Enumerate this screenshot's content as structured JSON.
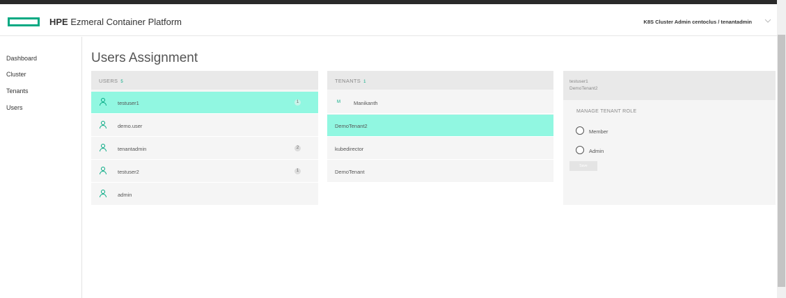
{
  "header": {
    "brand_bold": "HPE",
    "brand_rest": " Ezmeral Container Platform",
    "user_menu": "K8S Cluster Admin centoclus / tenantadmin"
  },
  "sidebar": {
    "items": [
      {
        "label": "Dashboard"
      },
      {
        "label": "Cluster"
      },
      {
        "label": "Tenants"
      },
      {
        "label": "Users"
      }
    ]
  },
  "page": {
    "title": "Users Assignment"
  },
  "users_panel": {
    "header_label": "USERS",
    "header_count": "5",
    "rows": [
      {
        "name": "testuser1",
        "count": "1",
        "selected": true
      },
      {
        "name": "demo.user",
        "count": null,
        "selected": false
      },
      {
        "name": "tenantadmin",
        "count": "2",
        "selected": false
      },
      {
        "name": "testuser2",
        "count": "1",
        "selected": false
      },
      {
        "name": "admin",
        "count": null,
        "selected": false
      }
    ]
  },
  "tenants_panel": {
    "header_label": "TENANTS",
    "header_count": "1",
    "rows": [
      {
        "name": "Manikanth",
        "prefix": "M",
        "selected": false
      },
      {
        "name": "DemoTenant2",
        "prefix": "",
        "selected": true
      },
      {
        "name": "kubedirector",
        "prefix": "",
        "selected": false
      },
      {
        "name": "DemoTenant",
        "prefix": "",
        "selected": false
      }
    ]
  },
  "detail_panel": {
    "user": "testuser1",
    "tenant": "DemoTenant2",
    "section_title": "MANAGE TENANT ROLE",
    "roles": [
      {
        "label": "Member"
      },
      {
        "label": "Admin"
      }
    ],
    "save_label": "Save"
  },
  "colors": {
    "accent": "#01a982",
    "selected_row": "#91f7e1",
    "topbar": "#2a2a2a"
  },
  "icons": {
    "logo": "hpe-logo-rectangle",
    "user": "person-outline-icon",
    "menu_chevron": "chevron-down-icon"
  }
}
